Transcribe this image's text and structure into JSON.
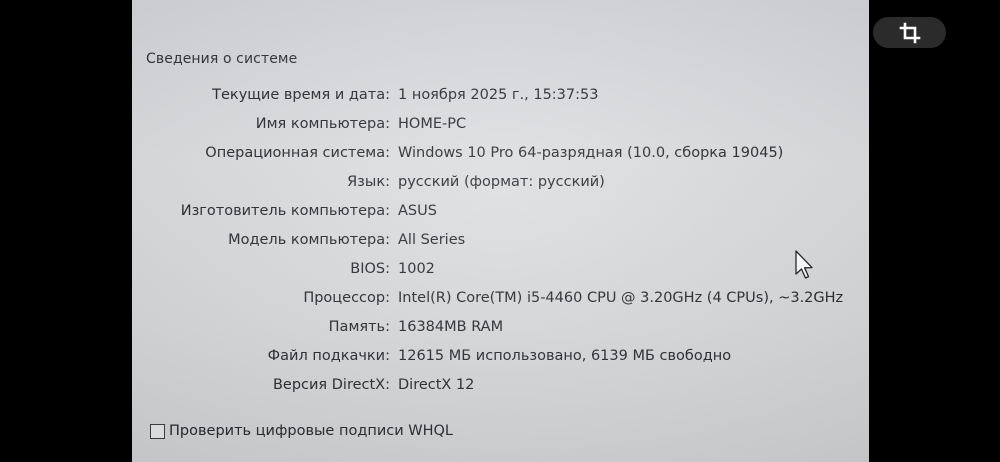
{
  "section_title": "Сведения о системе",
  "rows": [
    {
      "label": "Текущие время и дата",
      "value": "1 ноября 2025 г., 15:37:53"
    },
    {
      "label": "Имя компьютера",
      "value": "HOME-PC"
    },
    {
      "label": "Операционная система",
      "value": "Windows 10 Pro 64-разрядная (10.0, сборка 19045)"
    },
    {
      "label": "Язык",
      "value": "русский (формат: русский)"
    },
    {
      "label": "Изготовитель компьютера",
      "value": "ASUS"
    },
    {
      "label": "Модель компьютера",
      "value": "All Series"
    },
    {
      "label": "BIOS",
      "value": "1002"
    },
    {
      "label": "Процессор",
      "value": "Intel(R) Core(TM) i5-4460  CPU @ 3.20GHz (4 CPUs), ~3.2GHz"
    },
    {
      "label": "Память",
      "value": "16384MB RAM"
    },
    {
      "label": "Файл подкачки",
      "value": "12615 МБ использовано, 6139 МБ свободно"
    },
    {
      "label": "Версия DirectX",
      "value": "DirectX 12"
    }
  ],
  "whql_checkbox": {
    "label": "Проверить цифровые подписи WHQL",
    "checked": false
  },
  "icons": {
    "crop": "crop-icon",
    "cursor": "mouse-pointer-icon"
  },
  "colors": {
    "screen_bg": "#d6d8da",
    "text": "#222428",
    "pill_bg": "#2b2b2b"
  }
}
